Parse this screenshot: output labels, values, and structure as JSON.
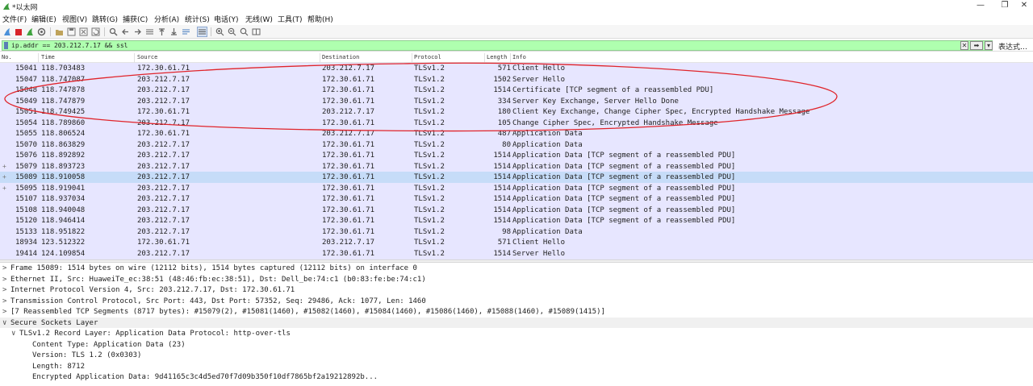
{
  "window": {
    "title": "*以太网",
    "controls": [
      "—",
      "❐",
      "✕"
    ]
  },
  "menu": [
    "文件(F)",
    "编辑(E)",
    "视图(V)",
    "跳转(G)",
    "捕获(C)",
    "分析(A)",
    "统计(S)",
    "电话(Y)",
    "无线(W)",
    "工具(T)",
    "帮助(H)"
  ],
  "filter": {
    "value": "ip.addr == 203.212.7.17 && ssl",
    "expression_label": "表达式…",
    "color": "#afffaf"
  },
  "columns": [
    "No.",
    "Time",
    "Source",
    "Destination",
    "Protocol",
    "Length",
    "Info"
  ],
  "packets": [
    {
      "no": "15041",
      "time": "118.703483",
      "src": "172.30.61.71",
      "dst": "203.212.7.17",
      "proto": "TLSv1.2",
      "len": "571",
      "info": "Client Hello",
      "mark": ""
    },
    {
      "no": "15047",
      "time": "118.747087",
      "src": "203.212.7.17",
      "dst": "172.30.61.71",
      "proto": "TLSv1.2",
      "len": "1502",
      "info": "Server Hello",
      "mark": ""
    },
    {
      "no": "15048",
      "time": "118.747878",
      "src": "203.212.7.17",
      "dst": "172.30.61.71",
      "proto": "TLSv1.2",
      "len": "1514",
      "info": "Certificate [TCP segment of a reassembled PDU]",
      "mark": ""
    },
    {
      "no": "15049",
      "time": "118.747879",
      "src": "203.212.7.17",
      "dst": "172.30.61.71",
      "proto": "TLSv1.2",
      "len": "334",
      "info": "Server Key Exchange, Server Hello Done",
      "mark": ""
    },
    {
      "no": "15051",
      "time": "118.749425",
      "src": "172.30.61.71",
      "dst": "203.212.7.17",
      "proto": "TLSv1.2",
      "len": "180",
      "info": "Client Key Exchange, Change Cipher Spec, Encrypted Handshake Message",
      "mark": ""
    },
    {
      "no": "15054",
      "time": "118.789860",
      "src": "203.212.7.17",
      "dst": "172.30.61.71",
      "proto": "TLSv1.2",
      "len": "105",
      "info": "Change Cipher Spec, Encrypted Handshake Message",
      "mark": ""
    },
    {
      "no": "15055",
      "time": "118.806524",
      "src": "172.30.61.71",
      "dst": "203.212.7.17",
      "proto": "TLSv1.2",
      "len": "487",
      "info": "Application Data",
      "mark": ""
    },
    {
      "no": "15070",
      "time": "118.863829",
      "src": "203.212.7.17",
      "dst": "172.30.61.71",
      "proto": "TLSv1.2",
      "len": "80",
      "info": "Application Data",
      "mark": ""
    },
    {
      "no": "15076",
      "time": "118.892892",
      "src": "203.212.7.17",
      "dst": "172.30.61.71",
      "proto": "TLSv1.2",
      "len": "1514",
      "info": "Application Data [TCP segment of a reassembled PDU]",
      "mark": ""
    },
    {
      "no": "15079",
      "time": "118.893723",
      "src": "203.212.7.17",
      "dst": "172.30.61.71",
      "proto": "TLSv1.2",
      "len": "1514",
      "info": "Application Data [TCP segment of a reassembled PDU]",
      "mark": "+"
    },
    {
      "no": "15089",
      "time": "118.910058",
      "src": "203.212.7.17",
      "dst": "172.30.61.71",
      "proto": "TLSv1.2",
      "len": "1514",
      "info": "Application Data [TCP segment of a reassembled PDU]",
      "mark": "+",
      "selected": true
    },
    {
      "no": "15095",
      "time": "118.919041",
      "src": "203.212.7.17",
      "dst": "172.30.61.71",
      "proto": "TLSv1.2",
      "len": "1514",
      "info": "Application Data [TCP segment of a reassembled PDU]",
      "mark": "+"
    },
    {
      "no": "15107",
      "time": "118.937034",
      "src": "203.212.7.17",
      "dst": "172.30.61.71",
      "proto": "TLSv1.2",
      "len": "1514",
      "info": "Application Data [TCP segment of a reassembled PDU]",
      "mark": ""
    },
    {
      "no": "15108",
      "time": "118.940048",
      "src": "203.212.7.17",
      "dst": "172.30.61.71",
      "proto": "TLSv1.2",
      "len": "1514",
      "info": "Application Data [TCP segment of a reassembled PDU]",
      "mark": ""
    },
    {
      "no": "15120",
      "time": "118.946414",
      "src": "203.212.7.17",
      "dst": "172.30.61.71",
      "proto": "TLSv1.2",
      "len": "1514",
      "info": "Application Data [TCP segment of a reassembled PDU]",
      "mark": ""
    },
    {
      "no": "15133",
      "time": "118.951822",
      "src": "203.212.7.17",
      "dst": "172.30.61.71",
      "proto": "TLSv1.2",
      "len": "98",
      "info": "Application Data",
      "mark": ""
    },
    {
      "no": "18934",
      "time": "123.512322",
      "src": "172.30.61.71",
      "dst": "203.212.7.17",
      "proto": "TLSv1.2",
      "len": "571",
      "info": "Client Hello",
      "mark": ""
    },
    {
      "no": "19414",
      "time": "124.109854",
      "src": "203.212.7.17",
      "dst": "172.30.61.71",
      "proto": "TLSv1.2",
      "len": "1514",
      "info": "Server Hello",
      "mark": ""
    }
  ],
  "details": [
    {
      "arrow": ">",
      "text": "Frame 15089: 1514 bytes on wire (12112 bits), 1514 bytes captured (12112 bits) on interface 0",
      "level": 0
    },
    {
      "arrow": ">",
      "text": "Ethernet II, Src: HuaweiTe_ec:38:51 (48:46:fb:ec:38:51), Dst: Dell_be:74:c1 (b0:83:fe:be:74:c1)",
      "level": 0
    },
    {
      "arrow": ">",
      "text": "Internet Protocol Version 4, Src: 203.212.7.17, Dst: 172.30.61.71",
      "level": 0
    },
    {
      "arrow": ">",
      "text": "Transmission Control Protocol, Src Port: 443, Dst Port: 57352, Seq: 29486, Ack: 1077, Len: 1460",
      "level": 0
    },
    {
      "arrow": ">",
      "text": "[7 Reassembled TCP Segments (8717 bytes): #15079(2), #15081(1460), #15082(1460), #15084(1460), #15086(1460), #15088(1460), #15089(1415)]",
      "level": 0
    },
    {
      "arrow": "∨",
      "text": "Secure Sockets Layer",
      "level": 0
    },
    {
      "arrow": "∨",
      "text": "TLSv1.2 Record Layer: Application Data Protocol: http-over-tls",
      "level": 1
    },
    {
      "arrow": "",
      "text": "Content Type: Application Data (23)",
      "level": 2
    },
    {
      "arrow": "",
      "text": "Version: TLS 1.2 (0x0303)",
      "level": 2
    },
    {
      "arrow": "",
      "text": "Length: 8712",
      "level": 2
    },
    {
      "arrow": "",
      "text": "Encrypted Application Data: 9d41165c3c4d5ed70f7d09b350f10df7865bf2a19212892b...",
      "level": 2
    }
  ],
  "colors": {
    "packet_bg": "#e7e6ff",
    "selected_bg": "#c6dcf8",
    "annotation": "#e0242a"
  }
}
